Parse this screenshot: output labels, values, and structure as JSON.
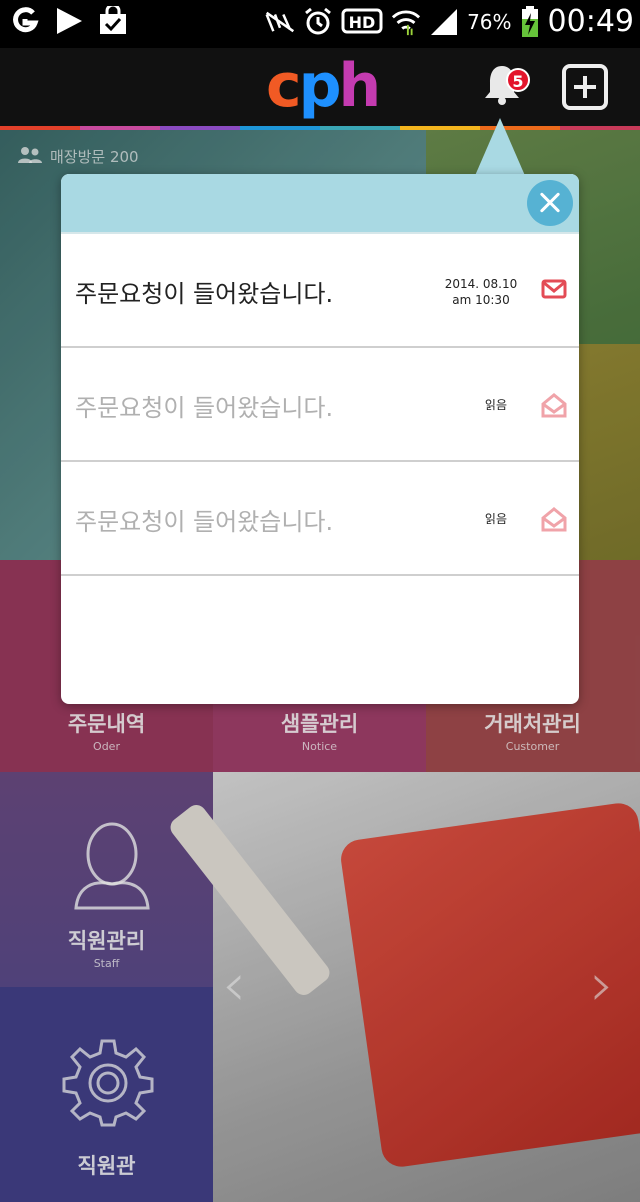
{
  "status_bar": {
    "battery": "76%",
    "clock": "00:49",
    "icons": [
      "g-app-icon",
      "play-store-icon",
      "shopping-bag-icon",
      "mute-icon",
      "alarm-icon",
      "hd-icon",
      "wifi-icon",
      "signal-icon",
      "battery-charging-icon"
    ]
  },
  "app_bar": {
    "logo_c": "c",
    "logo_p": "p",
    "logo_h": "h",
    "notification_count": "5"
  },
  "colors": {
    "popup_header": "#a9d9e3",
    "close_button": "#56b2d3",
    "mail_icon": "#e34b55",
    "mail_read_icon": "#f0a3a9",
    "stripe": [
      "#e2402a",
      "#c74a9d",
      "#8a4bc1",
      "#1e96d8",
      "#3aa6b5",
      "#f3b51e",
      "#ec6a1b",
      "#c83a59"
    ]
  },
  "background": {
    "visit_label": "매장방문 200",
    "tiles": [
      {
        "label": "주문내역",
        "sub": "Oder"
      },
      {
        "label": "샘플관리",
        "sub": "Notice"
      },
      {
        "label": "거래처관리",
        "sub": "Customer"
      },
      {
        "label": "직원관리",
        "sub": "Staff"
      },
      {
        "label": "직원관",
        "sub": ""
      }
    ]
  },
  "notifications": [
    {
      "text": "주문요청이 들어왔습니다.",
      "date": "2014. 08.10",
      "time": "am 10:30",
      "status": "unread"
    },
    {
      "text": "주문요청이 들어왔습니다.",
      "read_label": "읽음",
      "status": "read"
    },
    {
      "text": "주문요청이 들어왔습니다.",
      "read_label": "읽음",
      "status": "read"
    }
  ]
}
